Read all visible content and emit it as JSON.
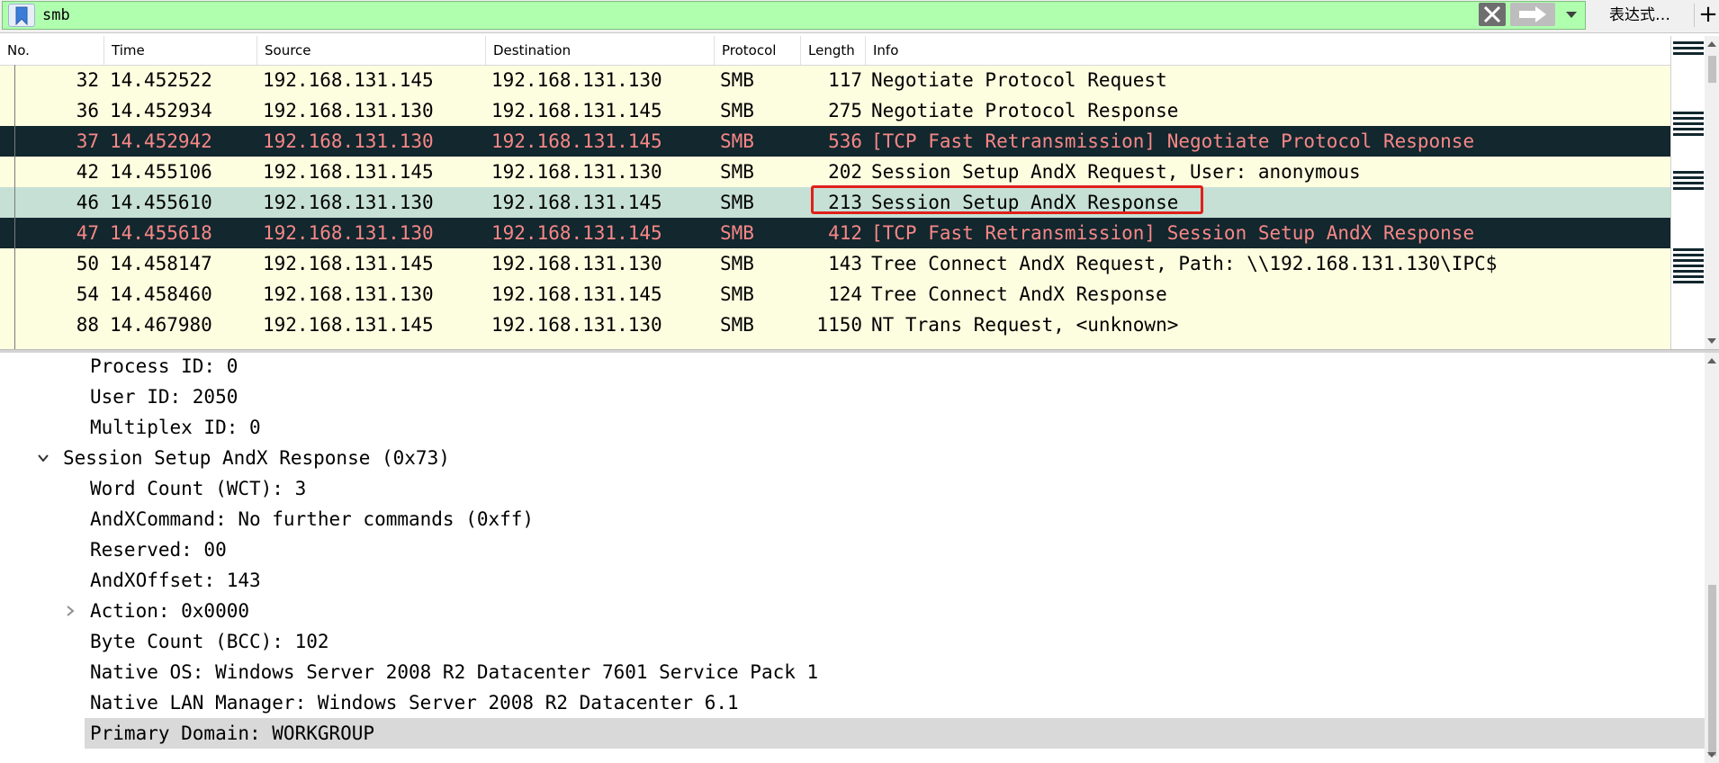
{
  "filter": {
    "value": "smb",
    "expression_label": "表达式…",
    "add_label": "+"
  },
  "columns": [
    "No.",
    "Time",
    "Source",
    "Destination",
    "Protocol",
    "Length",
    "Info"
  ],
  "packets": [
    {
      "no": "32",
      "time": "14.452522",
      "src": "192.168.131.145",
      "dst": "192.168.131.130",
      "proto": "SMB",
      "len": "117",
      "info": "Negotiate Protocol Request",
      "style": "normal"
    },
    {
      "no": "36",
      "time": "14.452934",
      "src": "192.168.131.130",
      "dst": "192.168.131.145",
      "proto": "SMB",
      "len": "275",
      "info": "Negotiate Protocol Response",
      "style": "normal"
    },
    {
      "no": "37",
      "time": "14.452942",
      "src": "192.168.131.130",
      "dst": "192.168.131.145",
      "proto": "SMB",
      "len": "536",
      "info": "[TCP Fast Retransmission] Negotiate Protocol Response",
      "style": "dark"
    },
    {
      "no": "42",
      "time": "14.455106",
      "src": "192.168.131.145",
      "dst": "192.168.131.130",
      "proto": "SMB",
      "len": "202",
      "info": "Session Setup AndX Request, User: anonymous",
      "style": "normal"
    },
    {
      "no": "46",
      "time": "14.455610",
      "src": "192.168.131.130",
      "dst": "192.168.131.145",
      "proto": "SMB",
      "len": "213",
      "info": "Session Setup AndX Response",
      "style": "selected"
    },
    {
      "no": "47",
      "time": "14.455618",
      "src": "192.168.131.130",
      "dst": "192.168.131.145",
      "proto": "SMB",
      "len": "412",
      "info": "[TCP Fast Retransmission] Session Setup AndX Response",
      "style": "dark"
    },
    {
      "no": "50",
      "time": "14.458147",
      "src": "192.168.131.145",
      "dst": "192.168.131.130",
      "proto": "SMB",
      "len": "143",
      "info": "Tree Connect AndX Request, Path: \\\\192.168.131.130\\IPC$",
      "style": "normal"
    },
    {
      "no": "54",
      "time": "14.458460",
      "src": "192.168.131.130",
      "dst": "192.168.131.145",
      "proto": "SMB",
      "len": "124",
      "info": "Tree Connect AndX Response",
      "style": "normal"
    },
    {
      "no": "88",
      "time": "14.467980",
      "src": "192.168.131.145",
      "dst": "192.168.131.130",
      "proto": "SMB",
      "len": "1150",
      "info": "NT Trans Request, <unknown>",
      "style": "normal"
    }
  ],
  "details": [
    {
      "text": "Process ID: 0",
      "indent": 2,
      "expander": "none"
    },
    {
      "text": "User ID: 2050",
      "indent": 2,
      "expander": "none"
    },
    {
      "text": "Multiplex ID: 0",
      "indent": 2,
      "expander": "none"
    },
    {
      "text": "Session Setup AndX Response (0x73)",
      "indent": 1,
      "expander": "open"
    },
    {
      "text": "Word Count (WCT): 3",
      "indent": 2,
      "expander": "none"
    },
    {
      "text": "AndXCommand: No further commands (0xff)",
      "indent": 2,
      "expander": "none"
    },
    {
      "text": "Reserved: 00",
      "indent": 2,
      "expander": "none"
    },
    {
      "text": "AndXOffset: 143",
      "indent": 2,
      "expander": "none"
    },
    {
      "text": "Action: 0x0000",
      "indent": 2,
      "expander": "closed"
    },
    {
      "text": "Byte Count (BCC): 102",
      "indent": 2,
      "expander": "none"
    },
    {
      "text": "Native OS: Windows Server 2008 R2 Datacenter 7601 Service Pack 1",
      "indent": 2,
      "expander": "none"
    },
    {
      "text": "Native LAN Manager: Windows Server 2008 R2 Datacenter 6.1",
      "indent": 2,
      "expander": "none"
    },
    {
      "text": "Primary Domain: WORKGROUP",
      "indent": 2,
      "expander": "none",
      "selected": true
    }
  ],
  "colors": {
    "filter_ok": "#afffaf",
    "row_normal": "#fdfde0",
    "row_dark": "#12272e",
    "row_dark_text": "#f78787",
    "row_selected": "#c6e0d6",
    "highlight_box": "#e0201a"
  }
}
